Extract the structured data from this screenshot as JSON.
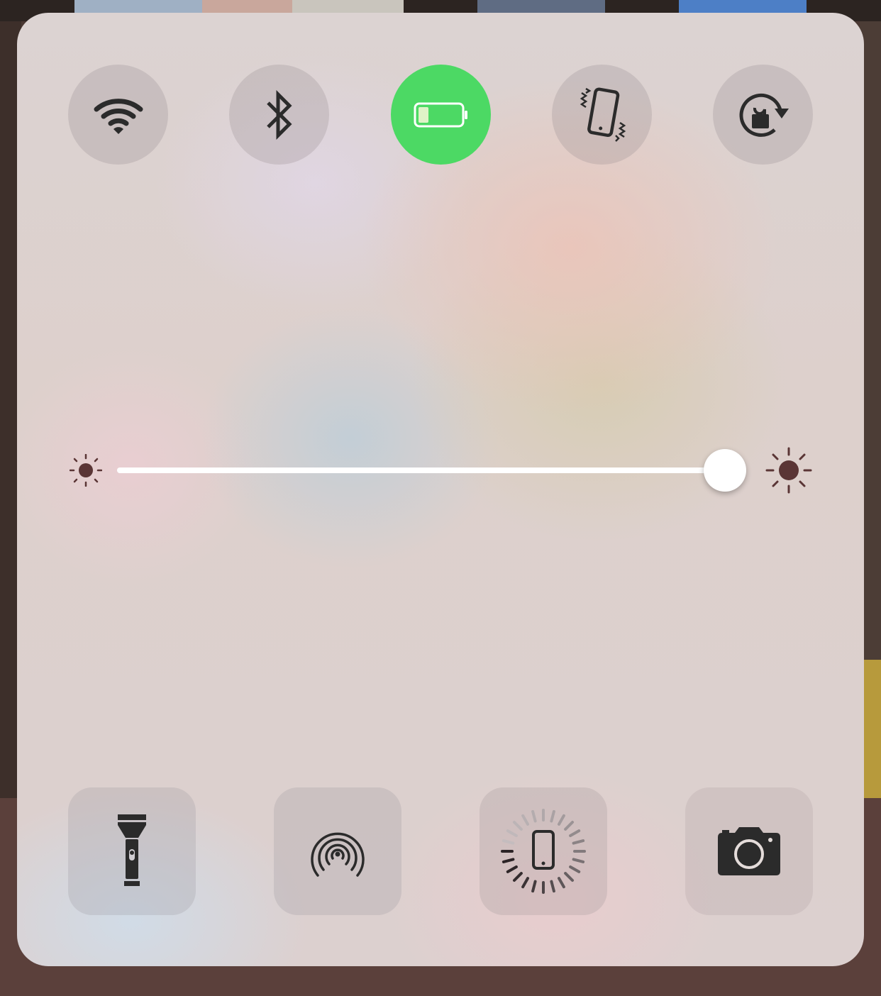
{
  "control_center": {
    "toggles": [
      {
        "id": "wifi",
        "icon": "wifi-icon",
        "active": false
      },
      {
        "id": "bluetooth",
        "icon": "bluetooth-icon",
        "active": false
      },
      {
        "id": "low-power-mode",
        "icon": "battery-icon",
        "active": true
      },
      {
        "id": "silent-mode",
        "icon": "vibrate-phone-icon",
        "active": false
      },
      {
        "id": "orientation-lock",
        "icon": "orientation-lock-icon",
        "active": false
      }
    ],
    "brightness": {
      "min_icon": "sun-small-icon",
      "max_icon": "sun-large-icon",
      "level": 0.99
    },
    "shortcuts": [
      {
        "id": "flashlight",
        "icon": "flashlight-icon"
      },
      {
        "id": "airdrop",
        "icon": "airdrop-icon"
      },
      {
        "id": "screen-mirroring",
        "icon": "phone-spinner-icon"
      },
      {
        "id": "camera",
        "icon": "camera-icon"
      }
    ],
    "colors": {
      "active_toggle": "#4cd964",
      "icon": "#2b2b2b",
      "sun": "#5a3535",
      "slider_fill": "#ffffff"
    }
  }
}
